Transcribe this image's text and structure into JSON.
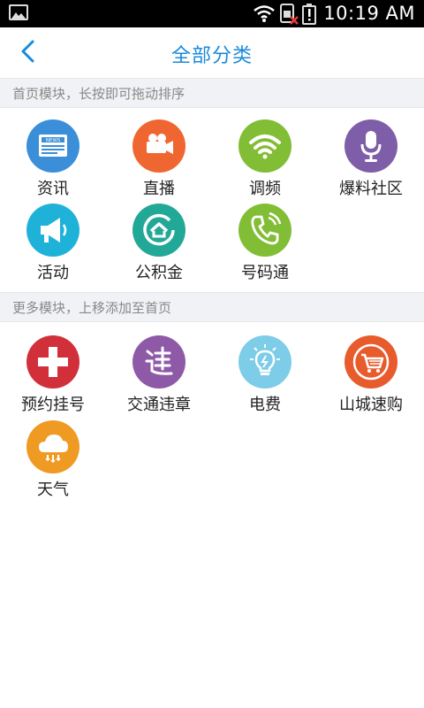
{
  "status_bar": {
    "time": "10:19 AM"
  },
  "header": {
    "title": "全部分类"
  },
  "home_section": {
    "heading": "首页模块，长按即可拖动排序",
    "items": [
      {
        "label": "资讯",
        "color": "#3a8fd8",
        "icon": "news-icon"
      },
      {
        "label": "直播",
        "color": "#ef6630",
        "icon": "video-camera-icon"
      },
      {
        "label": "调频",
        "color": "#82bd36",
        "icon": "wifi-signal-icon"
      },
      {
        "label": "爆料社区",
        "color": "#7f5ea9",
        "icon": "microphone-icon"
      },
      {
        "label": "活动",
        "color": "#1fb2d9",
        "icon": "megaphone-icon"
      },
      {
        "label": "公积金",
        "color": "#22a897",
        "icon": "home-fund-icon"
      },
      {
        "label": "号码通",
        "color": "#82bd36",
        "icon": "phone-icon"
      }
    ]
  },
  "more_section": {
    "heading": "更多模块，上移添加至首页",
    "items": [
      {
        "label": "预约挂号",
        "color": "#d1303a",
        "icon": "medical-cross-icon"
      },
      {
        "label": "交通违章",
        "color": "#8e5aa7",
        "icon": "traffic-violation-icon"
      },
      {
        "label": "电费",
        "color": "#7dcce8",
        "icon": "lightbulb-icon"
      },
      {
        "label": "山城速购",
        "color": "#e85b2c",
        "icon": "shopping-cart-icon"
      },
      {
        "label": "天气",
        "color": "#ef9a23",
        "icon": "weather-cloud-icon"
      }
    ]
  }
}
